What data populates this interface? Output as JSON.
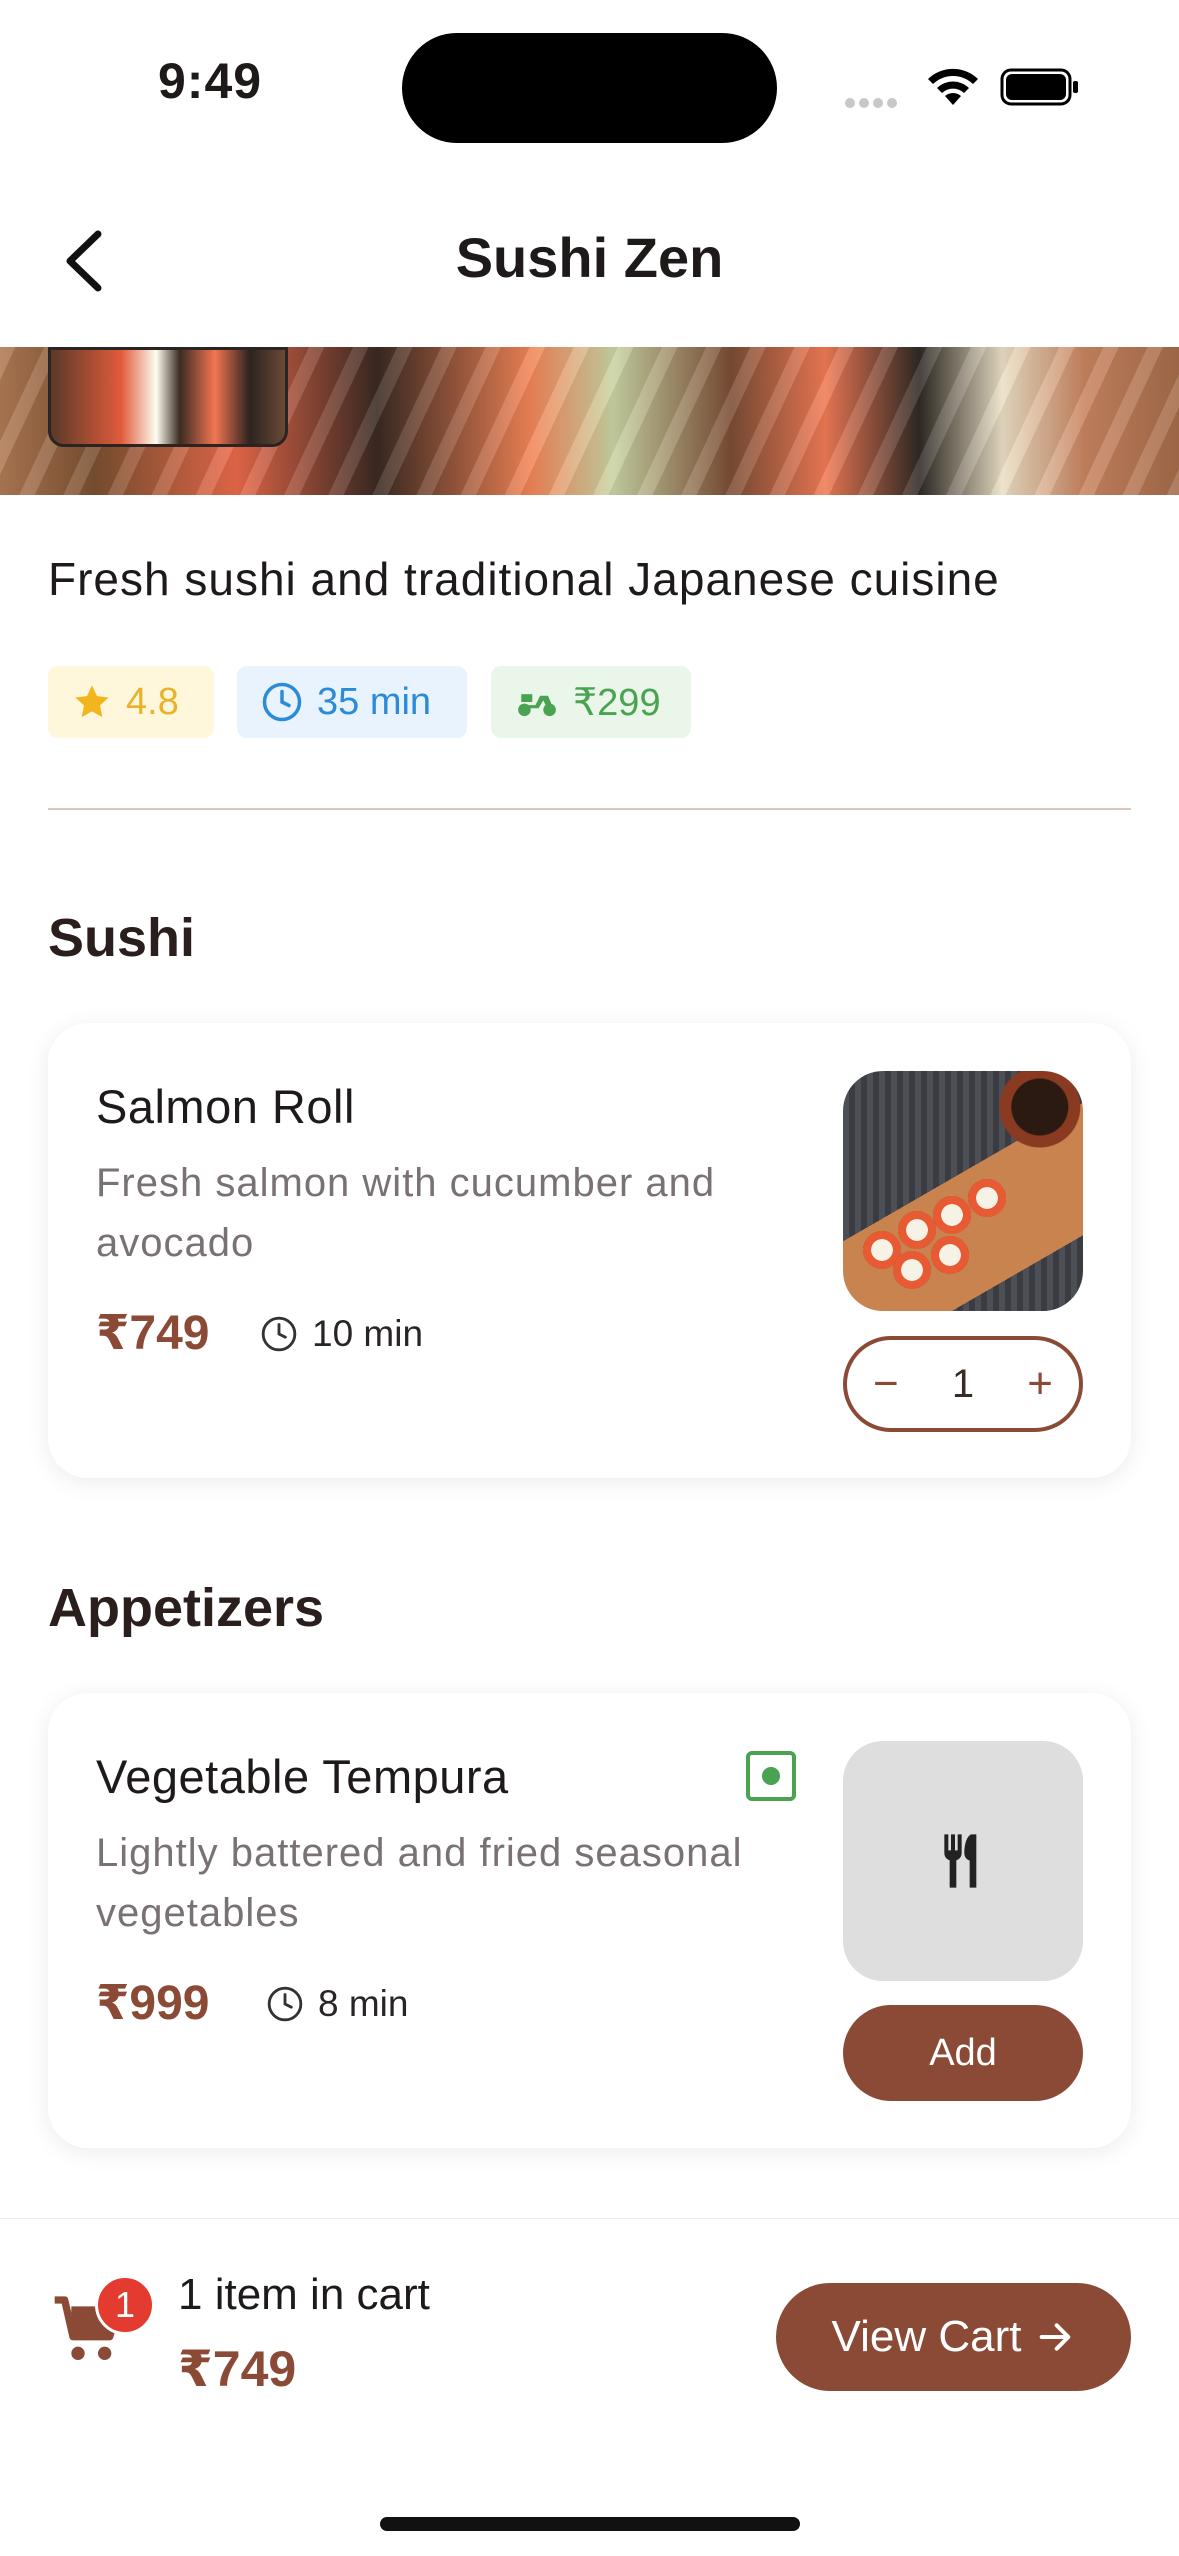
{
  "status_bar": {
    "time": "9:49"
  },
  "header": {
    "title": "Sushi Zen",
    "back_icon": "chevron-left-icon"
  },
  "restaurant": {
    "description": "Fresh sushi and traditional Japanese cuisine",
    "rating": "4.8",
    "delivery_time": "35 min",
    "delivery_fee": "₹299"
  },
  "sections": [
    {
      "title": "Sushi",
      "items": [
        {
          "name": "Salmon Roll",
          "description": "Fresh salmon with cucumber and avocado",
          "price": "₹749",
          "prep_time": "10 min",
          "quantity": "1"
        }
      ]
    },
    {
      "title": "Appetizers",
      "items": [
        {
          "name": "Vegetable Tempura",
          "description": "Lightly battered and fried seasonal vegetables",
          "price": "₹999",
          "prep_time": "8 min",
          "action_label": "Add"
        }
      ]
    }
  ],
  "cart_bar": {
    "badge_count": "1",
    "count_label": "1 item in cart",
    "total": "₹749",
    "button_label": "View Cart"
  },
  "colors": {
    "accent": "#8a4a36",
    "rating": "#e9b22b",
    "time": "#2b8bd9",
    "fee": "#4aa350",
    "badge": "#e43b30"
  }
}
